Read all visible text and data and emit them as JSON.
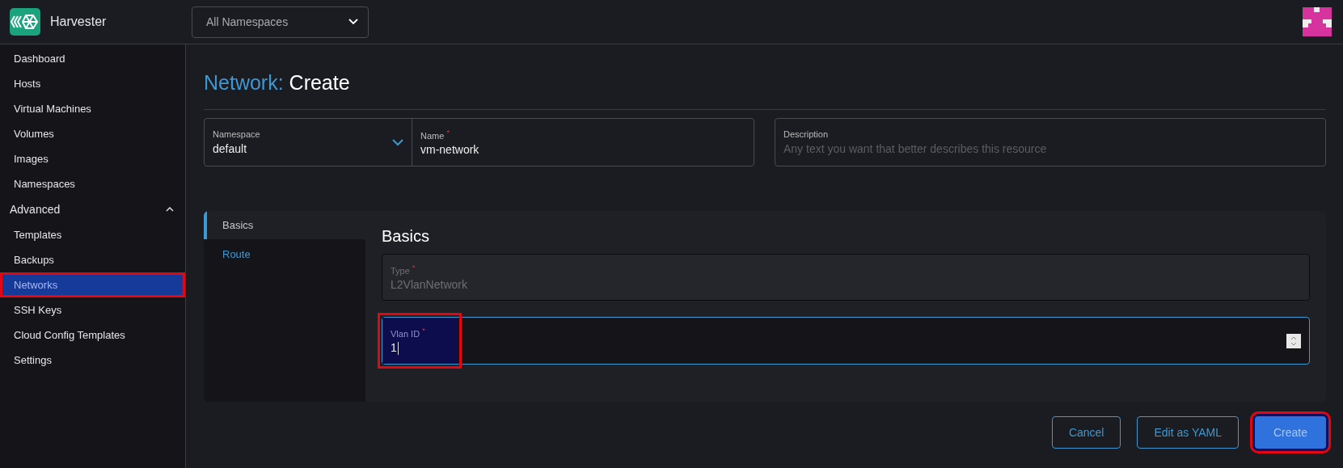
{
  "header": {
    "product": "Harvester",
    "namespace_filter": {
      "value": "All Namespaces"
    }
  },
  "sidebar": {
    "items": [
      {
        "kind": "link",
        "label": "Dashboard",
        "selected": false,
        "highlighted": false
      },
      {
        "kind": "link",
        "label": "Hosts",
        "selected": false,
        "highlighted": false
      },
      {
        "kind": "link",
        "label": "Virtual Machines",
        "selected": false,
        "highlighted": false
      },
      {
        "kind": "link",
        "label": "Volumes",
        "selected": false,
        "highlighted": false
      },
      {
        "kind": "link",
        "label": "Images",
        "selected": false,
        "highlighted": false
      },
      {
        "kind": "link",
        "label": "Namespaces",
        "selected": false,
        "highlighted": false
      },
      {
        "kind": "group",
        "label": "Advanced",
        "expanded": true,
        "children": [
          {
            "label": "Templates",
            "selected": false,
            "highlighted": false
          },
          {
            "label": "Backups",
            "selected": false,
            "highlighted": false
          },
          {
            "label": "Networks",
            "selected": true,
            "highlighted": true
          },
          {
            "label": "SSH Keys",
            "selected": false,
            "highlighted": false
          },
          {
            "label": "Cloud Config Templates",
            "selected": false,
            "highlighted": false
          },
          {
            "label": "Settings",
            "selected": false,
            "highlighted": false
          }
        ]
      }
    ]
  },
  "page": {
    "title_resource": "Network:",
    "title_action": "Create"
  },
  "fields": {
    "namespace": {
      "label": "Namespace",
      "value": "default"
    },
    "name": {
      "label": "Name",
      "required_mark": "*",
      "value": "vm-network"
    },
    "description": {
      "label": "Description",
      "placeholder": "Any text you want that better describes this resource"
    }
  },
  "tabs": [
    {
      "label": "Basics",
      "selected": true
    },
    {
      "label": "Route",
      "selected": false
    }
  ],
  "section": {
    "title": "Basics",
    "type_field": {
      "label": "Type",
      "required_mark": "*",
      "value": "L2VlanNetwork",
      "disabled": true
    },
    "vlan_field": {
      "label": "Vlan ID",
      "required_mark": "*",
      "value": "1",
      "focused": true,
      "highlighted": true
    }
  },
  "buttons": [
    {
      "kind": "outline",
      "label": "Cancel",
      "highlighted": false
    },
    {
      "kind": "outline",
      "label": "Edit as YAML",
      "highlighted": false
    },
    {
      "kind": "primary",
      "label": "Create",
      "highlighted": true
    }
  ]
}
